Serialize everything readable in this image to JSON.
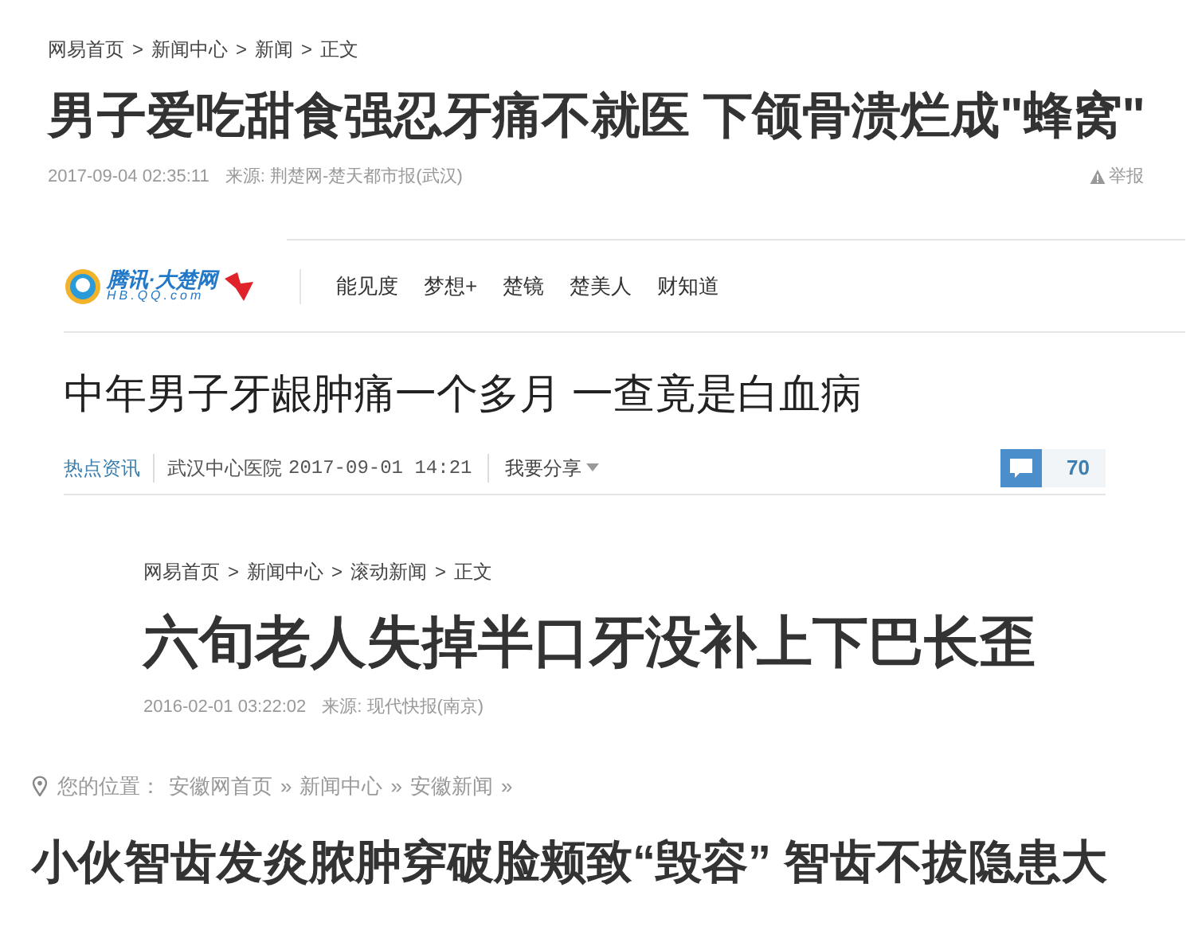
{
  "articles": [
    {
      "kind": "netease",
      "breadcrumb": {
        "items": [
          "网易首页",
          "新闻中心",
          "新闻",
          "正文"
        ],
        "separator": ">"
      },
      "title": "男子爱吃甜食强忍牙痛不就医 下颌骨溃烂成\"蜂窝\"",
      "date": "2017-09-04 02:35:11",
      "source": "来源: 荆楚网-楚天都市报(武汉)",
      "report": "举报"
    },
    {
      "kind": "tencent",
      "logo": {
        "name": "腾讯·大楚网",
        "domain": "HB.QQ.com"
      },
      "nav": [
        "能见度",
        "梦想+",
        "楚镜",
        "楚美人",
        "财知道"
      ],
      "title": "中年男子牙龈肿痛一个多月 一查竟是白血病",
      "category": "热点资讯",
      "source": "武汉中心医院",
      "date": "2017-09-01 14:21",
      "share": "我要分享",
      "comments": "70"
    },
    {
      "kind": "netease",
      "breadcrumb": {
        "items": [
          "网易首页",
          "新闻中心",
          "滚动新闻",
          "正文"
        ],
        "separator": ">"
      },
      "title": "六旬老人失掉半口牙没补上下巴长歪",
      "date": "2016-02-01 03:22:02",
      "source": "来源: 现代快报(南京)"
    },
    {
      "kind": "anhui",
      "breadcrumb": {
        "label": "您的位置：",
        "items": [
          "安徽网首页",
          "新闻中心",
          "安徽新闻"
        ],
        "separator": "»",
        "trailing_separator": true
      },
      "title": "小伙智齿发炎脓肿穿破脸颊致“毁容” 智齿不拔隐患大"
    }
  ]
}
